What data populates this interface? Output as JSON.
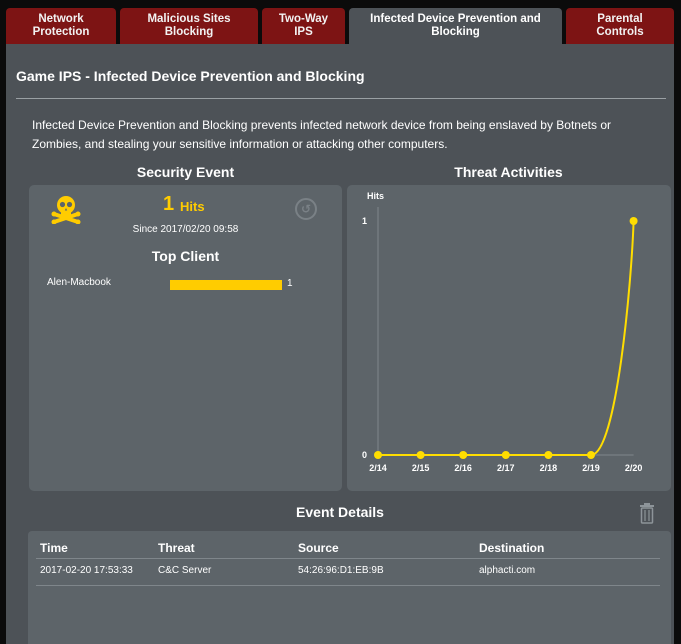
{
  "tabs": [
    {
      "label": "Network\nProtection",
      "active": false
    },
    {
      "label": "Malicious Sites\nBlocking",
      "active": false
    },
    {
      "label": "Two-Way\nIPS",
      "active": false
    },
    {
      "label": "Infected Device Prevention and\nBlocking",
      "active": true
    },
    {
      "label": "Parental\nControls",
      "active": false
    }
  ],
  "page": {
    "title": "Game IPS - Infected Device Prevention and Blocking",
    "description": "Infected Device Prevention and Blocking prevents infected network device from being enslaved by Botnets or Zombies, and stealing your sensitive information or attacking other computers."
  },
  "security_event": {
    "heading": "Security Event",
    "hits_count": "1",
    "hits_label": "Hits",
    "since": "Since 2017/02/20 09:58",
    "top_client_title": "Top Client",
    "clients": [
      {
        "name": "Alen-Macbook",
        "count": "1",
        "fraction": 1.0
      }
    ],
    "icon": "skull-icon",
    "reset_icon": "reset-icon"
  },
  "threat_activities": {
    "heading": "Threat Activities"
  },
  "chart_data": {
    "type": "line",
    "ylabel": "Hits",
    "categories": [
      "2/14",
      "2/15",
      "2/16",
      "2/17",
      "2/18",
      "2/19",
      "2/20"
    ],
    "series": [
      {
        "values": [
          0,
          0,
          0,
          0,
          0,
          0,
          1
        ]
      }
    ],
    "ylim": [
      0,
      1
    ],
    "yticks": [
      "0",
      "1"
    ],
    "line_color": "#ffdd00",
    "grid": false
  },
  "event_details": {
    "heading": "Event Details",
    "columns": [
      "Time",
      "Threat",
      "Source",
      "Destination"
    ],
    "rows": [
      [
        "2017-02-20 17:53:33",
        "C&C Server",
        "54:26:96:D1:EB:9B",
        "alphacti.com"
      ]
    ]
  },
  "colors": {
    "tab_inactive": "#7d1414",
    "panel": "#4d5257",
    "card": "#5d6469",
    "accent": "#ffcc00"
  }
}
